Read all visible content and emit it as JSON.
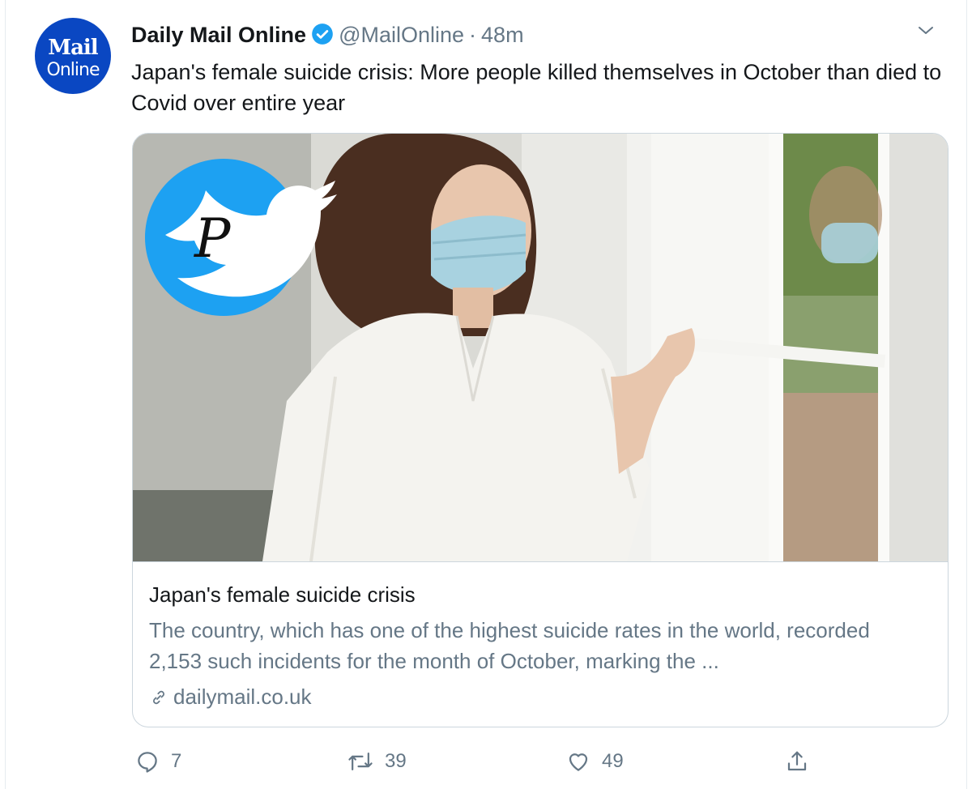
{
  "author": {
    "avatar_text_top": "Mail",
    "avatar_text_bottom": "Online",
    "display_name": "Daily Mail Online",
    "handle": "@MailOnline",
    "separator": "·",
    "time": "48m",
    "verified": true,
    "avatar_color": "#0a47c2",
    "verified_color": "#1da1f2"
  },
  "tweet": {
    "text": "Japan's female suicide crisis: More people killed themselves in October than died to Covid over entire year"
  },
  "card": {
    "image_overlay_letter": "P",
    "title": "Japan's female suicide crisis",
    "description": "The country, which has one of the highest suicide rates in the world, recorded 2,153 such incidents for the month of October, marking the ...",
    "link": "dailymail.co.uk"
  },
  "actions": {
    "reply_count": "7",
    "retweet_count": "39",
    "like_count": "49",
    "icons": [
      "reply-icon",
      "retweet-icon",
      "like-icon",
      "share-icon"
    ]
  }
}
